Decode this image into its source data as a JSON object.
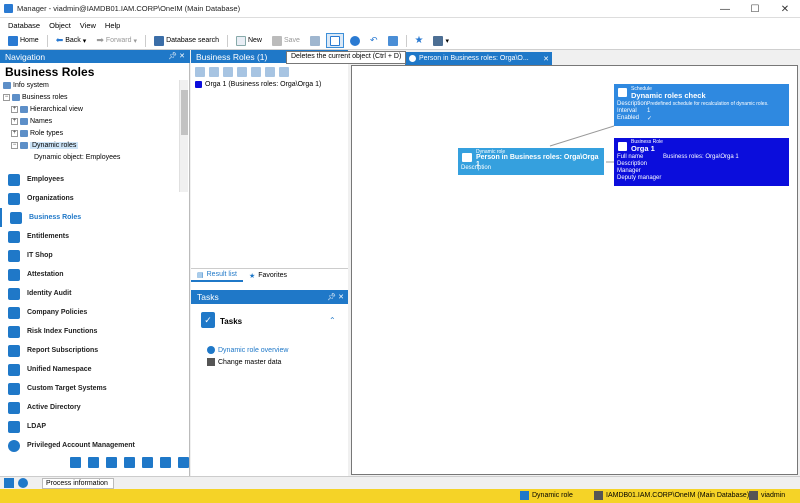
{
  "window": {
    "title": "Manager - viadmin@IAMDB01.IAM.CORP\\OneIM (Main Database)",
    "minimize": "—",
    "maximize": "☐",
    "close": "✕"
  },
  "menu": [
    "Database",
    "Object",
    "View",
    "Help"
  ],
  "toolbar": {
    "home": "Home",
    "back": "Back",
    "forward": "Forward",
    "db_search": "Database search",
    "new": "New",
    "save": "Save"
  },
  "tooltip": "Deletes the current object (Ctrl + D)",
  "navigation": {
    "header": "Navigation",
    "heading": "Business Roles",
    "tree": [
      {
        "label": "Info system",
        "indent": 0
      },
      {
        "label": "Business roles",
        "indent": 0
      },
      {
        "label": "Hierarchical view",
        "indent": 1
      },
      {
        "label": "Names",
        "indent": 1
      },
      {
        "label": "Role types",
        "indent": 1
      },
      {
        "label": "Dynamic roles",
        "indent": 1
      },
      {
        "label": "Dynamic object: Employees",
        "indent": 2
      }
    ],
    "items": [
      "Employees",
      "Organizations",
      "Business Roles",
      "Entitlements",
      "IT Shop",
      "Attestation",
      "Identity Audit",
      "Company Policies",
      "Risk Index Functions",
      "Report Subscriptions",
      "Unified Namespace",
      "Custom Target Systems",
      "Active Directory",
      "LDAP",
      "Privileged Account Management"
    ],
    "selected": "Business Roles"
  },
  "middle": {
    "header": "Business Roles (1)",
    "row": "Orga 1 (Business roles: Orga\\Orga 1)",
    "tab_result": "Result list",
    "tab_favorites": "Favorites"
  },
  "tasks": {
    "header": "Tasks",
    "title": "Tasks",
    "links": [
      "Dynamic role overview",
      "Change master data"
    ]
  },
  "right": {
    "tab": "Person in Business roles: Orga\\O...",
    "nodes": {
      "schedule": {
        "type": "Schedule",
        "title": "Dynamic roles check",
        "rows": [
          [
            "Description",
            "Predefined schedule for recalculation of dynamic roles."
          ],
          [
            "Interval",
            "1"
          ],
          [
            "Enabled",
            "✓"
          ]
        ]
      },
      "dynrole": {
        "type": "Dynamic role",
        "title": "Person in Business roles: Orga\\Orga 1",
        "rows": [
          [
            "Description",
            ""
          ]
        ]
      },
      "busrole": {
        "type": "Business Role",
        "title": "Orga 1",
        "rows": [
          [
            "Full name",
            "Business roles: Orga\\Orga 1"
          ],
          [
            "Description",
            ""
          ],
          [
            "Manager",
            ""
          ],
          [
            "Deputy manager",
            ""
          ]
        ]
      }
    }
  },
  "status": {
    "process_info": "Process information",
    "type": "Dynamic role",
    "db": "IAMDB01.IAM.CORP\\OneIM (Main Database)",
    "user": "viadmin"
  },
  "colors": {
    "accent": "#1f78c8",
    "schedule": "#2f89e0",
    "dynrole": "#35a0de",
    "busrole": "#0b0ddc",
    "statusbar": "#f5d327"
  }
}
